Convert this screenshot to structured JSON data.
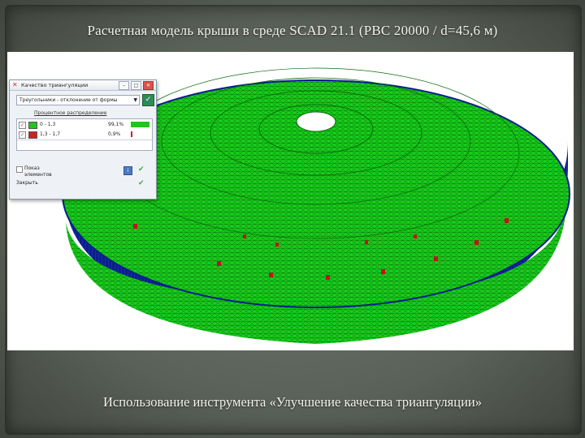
{
  "slide": {
    "title": "Расчетная модель крыши в среде SCAD 21.1 (PBC 20000 / d=45,6 м)",
    "caption": "Использование инструмента «Улучшение качества триангуляции»"
  },
  "dialog": {
    "title": "Качество триангуляции",
    "dropdown_value": "Треугольники - отклонение от формы",
    "group_label": "Процентное распределение",
    "rows": [
      {
        "range": "0 - 1,3",
        "value": "99,1%",
        "color": "#22c41f",
        "bar_fraction": 0.95
      },
      {
        "range": "1,3 - 1,7",
        "value": "0,9%",
        "color": "#d21f1f",
        "bar_fraction": 0.08
      }
    ],
    "footer_checkbox_label": "Показ",
    "footer_checkbox_sublabel": "элементов",
    "footer_action": "Закрыть"
  },
  "colors": {
    "mesh_green": "#18d11b",
    "mesh_line": "#0a5a0a",
    "rim_blue": "#0a1f8c",
    "defect_red": "#c0141a"
  }
}
